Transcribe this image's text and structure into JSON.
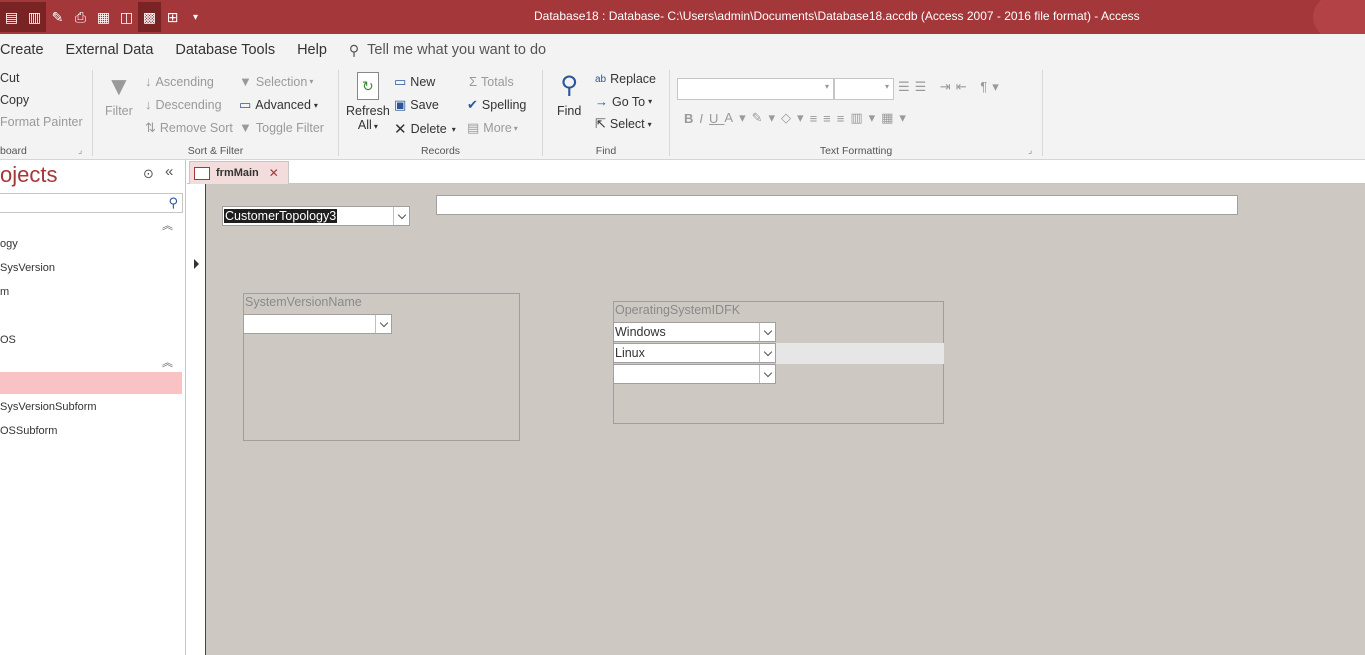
{
  "window": {
    "title": "Database18 : Database- C:\\Users\\admin\\Documents\\Database18.accdb (Access 2007 - 2016 file format)  -  Access"
  },
  "menu": {
    "items": [
      "Create",
      "External Data",
      "Database Tools",
      "Help"
    ],
    "tell_me": "Tell me what you want to do"
  },
  "ribbon": {
    "clipboard": {
      "cut": "Cut",
      "copy": "Copy",
      "format_painter": "Format Painter",
      "label": "board"
    },
    "sort_filter": {
      "filter": "Filter",
      "ascending": "Ascending",
      "descending": "Descending",
      "remove_sort": "Remove Sort",
      "selection": "Selection",
      "advanced": "Advanced",
      "toggle_filter": "Toggle Filter",
      "label": "Sort & Filter"
    },
    "records": {
      "refresh": "Refresh",
      "refresh_all": "All",
      "new": "New",
      "save": "Save",
      "delete": "Delete",
      "totals": "Totals",
      "spelling": "Spelling",
      "more": "More",
      "label": "Records"
    },
    "find": {
      "find": "Find",
      "replace": "Replace",
      "goto": "Go To",
      "select": "Select",
      "label": "Find"
    },
    "text_formatting": {
      "label": "Text Formatting"
    }
  },
  "nav": {
    "title": "ojects",
    "items": [
      "ogy",
      "SysVersion",
      "m",
      "",
      "OS",
      "",
      "SysVersionSubform",
      "OSSubform"
    ]
  },
  "tab": {
    "label": "frmMain"
  },
  "form": {
    "top_combo_value": "CustomerTopology3",
    "subform_sysversion": {
      "label": "SystemVersionName"
    },
    "subform_os": {
      "label": "OperatingSystemIDFK",
      "rows": [
        "Windows",
        "Linux",
        ""
      ]
    }
  }
}
